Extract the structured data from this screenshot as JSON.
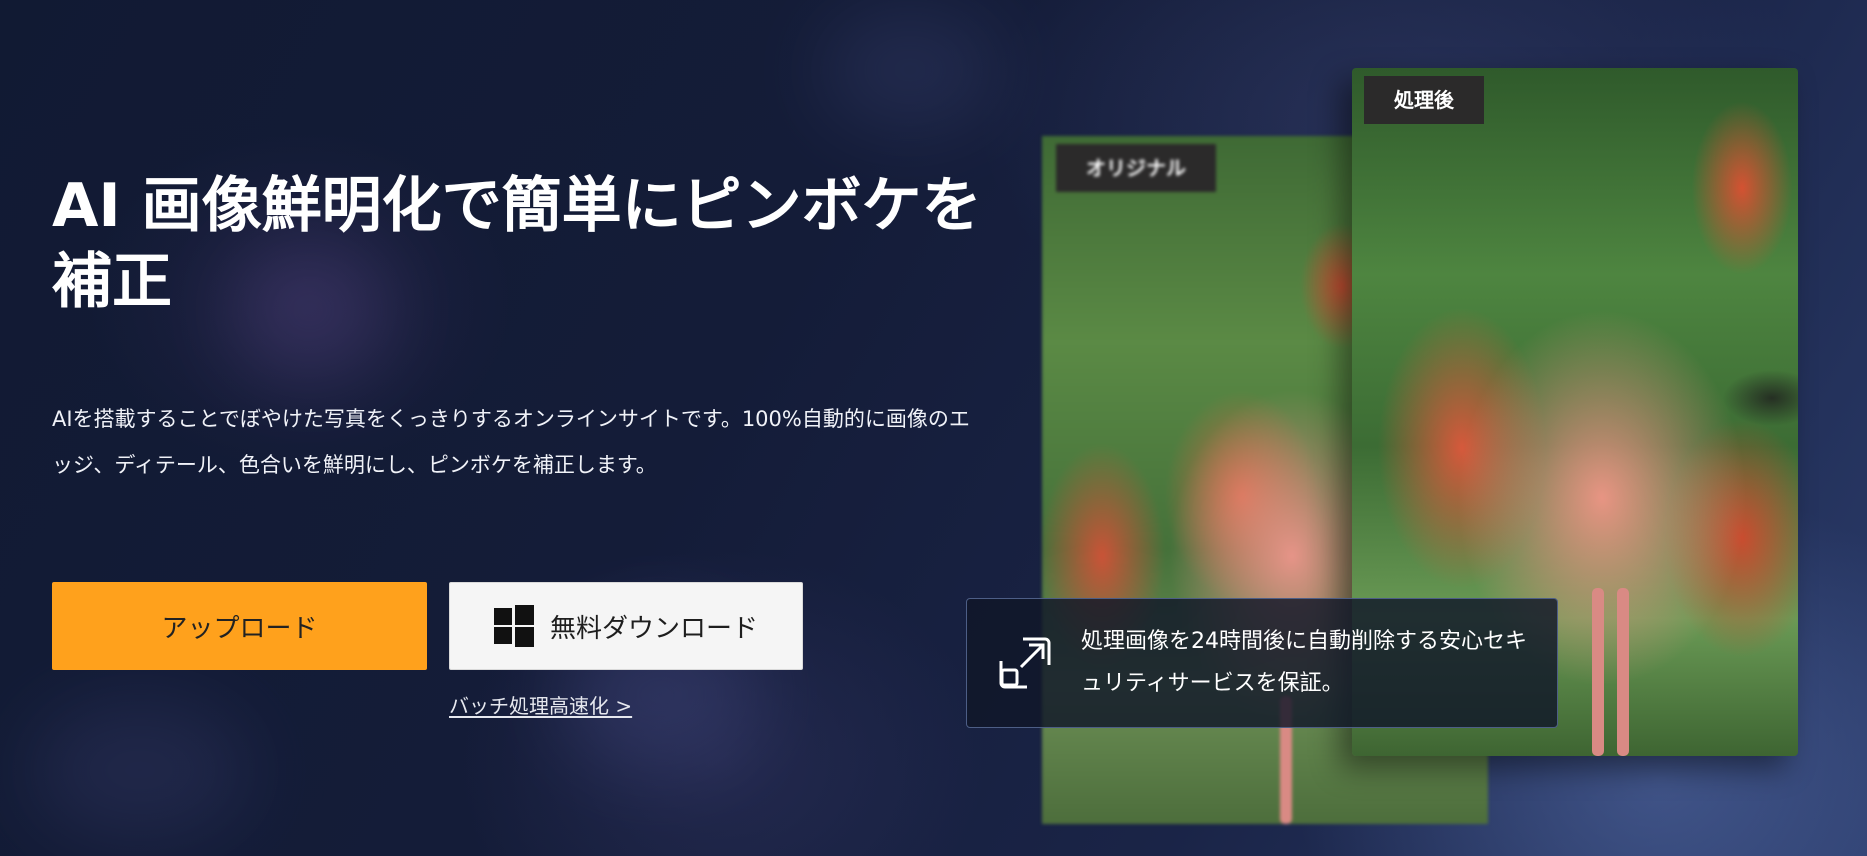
{
  "hero": {
    "title": "AI 画像鮮明化で簡単にピンボケを補正",
    "description": "AIを搭載することでぼやけた写真をくっきりするオンラインサイトです。100%自動的に画像のエッジ、ディテール、色合いを鮮明にし、ピンボケを補正します。"
  },
  "actions": {
    "upload_label": "アップロード",
    "download_label": "無料ダウンロード",
    "download_icon": "windows-icon",
    "batch_link": "バッチ処理高速化 >"
  },
  "comparison": {
    "original_label": "オリジナル",
    "processed_label": "処理後"
  },
  "security": {
    "icon": "open-external-icon",
    "text": "処理画像を24時間後に自動削除する安心セキュリティサービスを保証。"
  },
  "colors": {
    "accent": "#ffa11c",
    "background": "#141c38"
  }
}
